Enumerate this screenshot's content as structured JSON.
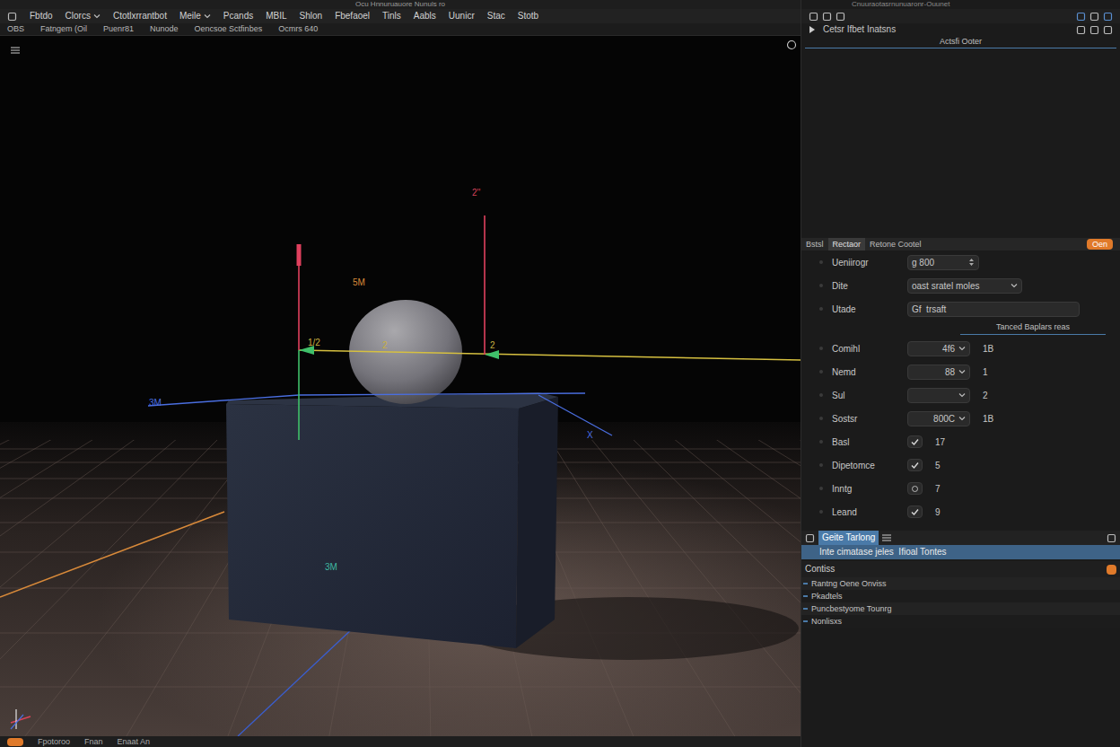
{
  "window": {
    "title": "Ocu Hnnuruauore Nunuls ro",
    "panel_title": "Cnuuraotasrnunuaronr-Ouunet"
  },
  "menu": [
    {
      "label": "Fbtdo",
      "kind": "plain"
    },
    {
      "label": "Clorcs",
      "kind": "dropdown"
    },
    {
      "label": "Ctotlxrrantbot",
      "kind": "plain"
    },
    {
      "label": "Meile",
      "kind": "dropdown"
    },
    {
      "label": "Pcands",
      "kind": "plain"
    },
    {
      "label": "MBIL",
      "kind": "plain"
    },
    {
      "label": "Shlon",
      "kind": "plain"
    },
    {
      "label": "Fbefaoel",
      "kind": "plain"
    },
    {
      "label": "Tinls",
      "kind": "plain"
    },
    {
      "label": "Aabls",
      "kind": "plain"
    },
    {
      "label": "Uunicr",
      "kind": "plain"
    },
    {
      "label": "Stac",
      "kind": "plain"
    },
    {
      "label": "Stotb",
      "kind": "plain"
    }
  ],
  "toolbar": [
    "OBS",
    "Fatngem (Oil",
    "Puenr81",
    "Nunode",
    "Oencsoe Sctfinbes",
    "Ocmrs 640"
  ],
  "viewport": {
    "labels": [
      {
        "text": "2''",
        "color": "#d9435a"
      },
      {
        "text": "5M",
        "color": "#d98a3a"
      },
      {
        "text": "1/2",
        "color": "#c9b040"
      },
      {
        "text": "2",
        "color": "#c9b040"
      },
      {
        "text": "2",
        "color": "#c9b040"
      },
      {
        "text": "3M",
        "color": "#4a6ee0"
      },
      {
        "text": "X",
        "color": "#4a6ee0"
      },
      {
        "text": "3M",
        "color": "#3fb8a0"
      }
    ]
  },
  "panel": {
    "header": "Cetsr Ifbet Inatsns",
    "subheader": "Actsfi Ooter",
    "tabs": [
      {
        "label": "Bstsl",
        "selected": false
      },
      {
        "label": "Rectaor",
        "selected": true
      },
      {
        "label": "Retone Cootel",
        "selected": false
      }
    ],
    "tab_button": "Oen",
    "properties": [
      {
        "label": "Ueniirogr",
        "kind": "spin",
        "value": "g 800"
      },
      {
        "label": "Dite",
        "kind": "select",
        "value": "oast sratel moles"
      },
      {
        "label": "Utade",
        "kind": "text",
        "value": "Gf  trsaft"
      }
    ],
    "group_title": "Tanced Baplars reas",
    "group_properties": [
      {
        "label": "Comihl",
        "kind": "select",
        "value": "4f6",
        "number": "1B"
      },
      {
        "label": "Nemd",
        "kind": "select",
        "value": "88",
        "number": "1"
      },
      {
        "label": "Sul",
        "kind": "select",
        "value": "",
        "number": "2"
      },
      {
        "label": "Sostsr",
        "kind": "select",
        "value": "800C",
        "number": "1B"
      },
      {
        "label": "Basl",
        "kind": "check",
        "checked": true,
        "number": "17"
      },
      {
        "label": "Dipetomce",
        "kind": "check",
        "checked": true,
        "number": "5"
      },
      {
        "label": "Inntg",
        "kind": "radio",
        "checked": false,
        "number": "7"
      },
      {
        "label": "Leand",
        "kind": "check",
        "checked": true,
        "number": "9"
      }
    ],
    "section": {
      "title": "Geite Tarlong",
      "row": "Inte cimatase jeles  Ifioal Tontes"
    },
    "list_title": "Contiss",
    "list": [
      "Rantng Oene Onviss",
      "Pkadtels",
      "Puncbestyome Tounrg",
      "Nonlisxs"
    ]
  },
  "status_bar": [
    "Fpotoroo",
    "Fnan",
    "Enaat An"
  ]
}
